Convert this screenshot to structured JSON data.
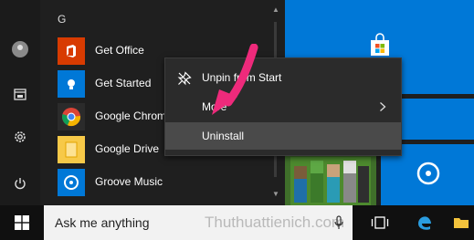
{
  "start_menu": {
    "section_letter": "G",
    "apps": [
      {
        "name": "Get Office",
        "tile_color": "#d83b01",
        "icon": "office-icon"
      },
      {
        "name": "Get Started",
        "tile_color": "#0078d7",
        "icon": "lightbulb-icon"
      },
      {
        "name": "Google Chrome",
        "tile_color": "#2b2b2b",
        "icon": "chrome-icon"
      },
      {
        "name": "Google Drive",
        "tile_color": "#f7c948",
        "icon": "drive-file-icon"
      },
      {
        "name": "Groove Music",
        "tile_color": "#0078d7",
        "icon": "groove-music-icon"
      }
    ],
    "rail_icons": [
      "user-avatar-icon",
      "file-explorer-icon",
      "settings-gear-icon",
      "power-icon"
    ]
  },
  "context_menu": {
    "items": [
      {
        "label": "Unpin from Start",
        "icon": "unpin-icon"
      },
      {
        "label": "More",
        "icon": "chevron-right-icon"
      },
      {
        "label": "Uninstall",
        "icon": ""
      }
    ]
  },
  "tiles": {
    "accent": "#0078d7",
    "store_icon": "store-bag-icon",
    "groove_icon": "groove-disc-icon",
    "minecraft_icon": "minecraft-characters-icon"
  },
  "taskbar": {
    "search_placeholder": "Ask me anything",
    "watermark": "Thuthuattienich.com",
    "icons": [
      "windows-logo-icon",
      "microphone-icon",
      "task-view-icon",
      "edge-icon",
      "folder-icon"
    ]
  },
  "annotation": {
    "arrow_color": "#ee2a7b"
  }
}
